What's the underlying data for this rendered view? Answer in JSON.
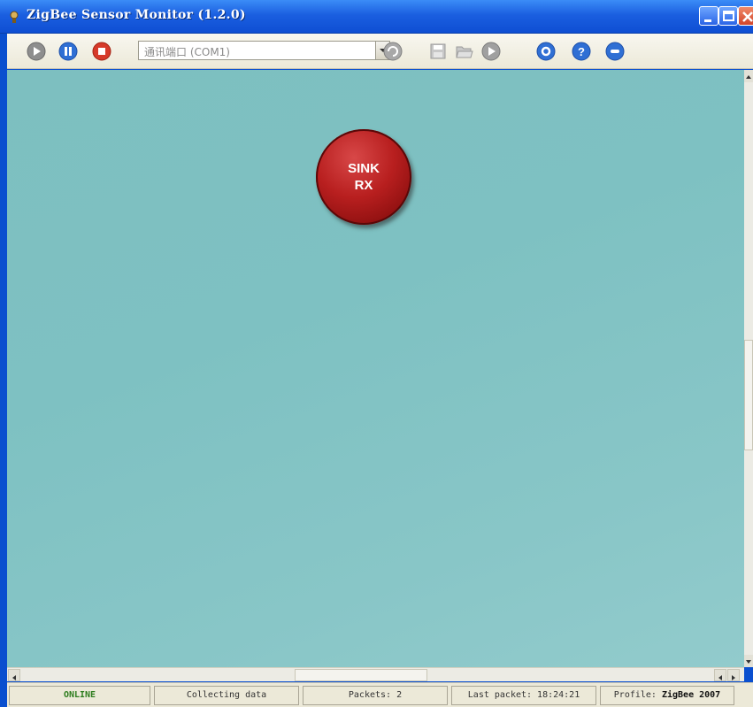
{
  "window": {
    "title": "ZigBee Sensor Monitor (1.2.0)"
  },
  "toolbar": {
    "buttons": [
      {
        "name": "start",
        "icon": "play-icon",
        "color": "#8a8a8a"
      },
      {
        "name": "pause",
        "icon": "pause-icon",
        "color": "#2f6fd4"
      },
      {
        "name": "stop",
        "icon": "stop-icon",
        "color": "#d63a2a"
      },
      {
        "name": "refresh",
        "icon": "refresh-icon",
        "color": "#9a9a9a"
      },
      {
        "name": "save",
        "icon": "save-icon",
        "color": "#b8b8b8"
      },
      {
        "name": "open",
        "icon": "folder-open-icon",
        "color": "#b8b8b8"
      },
      {
        "name": "run",
        "icon": "play-icon",
        "color": "#9a9a9a"
      },
      {
        "name": "settings",
        "icon": "settings-icon",
        "color": "#2f6fd4"
      },
      {
        "name": "help",
        "icon": "help-icon",
        "color": "#2f6fd4"
      },
      {
        "name": "about",
        "icon": "about-icon",
        "color": "#2f6fd4"
      }
    ],
    "port_select": {
      "value": "通讯端口 (COM1)"
    }
  },
  "canvas": {
    "background": "#7ec0c1",
    "node": {
      "line1": "SINK",
      "line2": "RX",
      "color": "#b81f1f"
    }
  },
  "statusbar": {
    "status": "ONLINE",
    "activity": "Collecting data",
    "packets": "Packets: 2",
    "last_packet": "Last packet: 18:24:21",
    "profile_prefix": "Profile: ",
    "profile_name": "ZigBee 2007"
  }
}
